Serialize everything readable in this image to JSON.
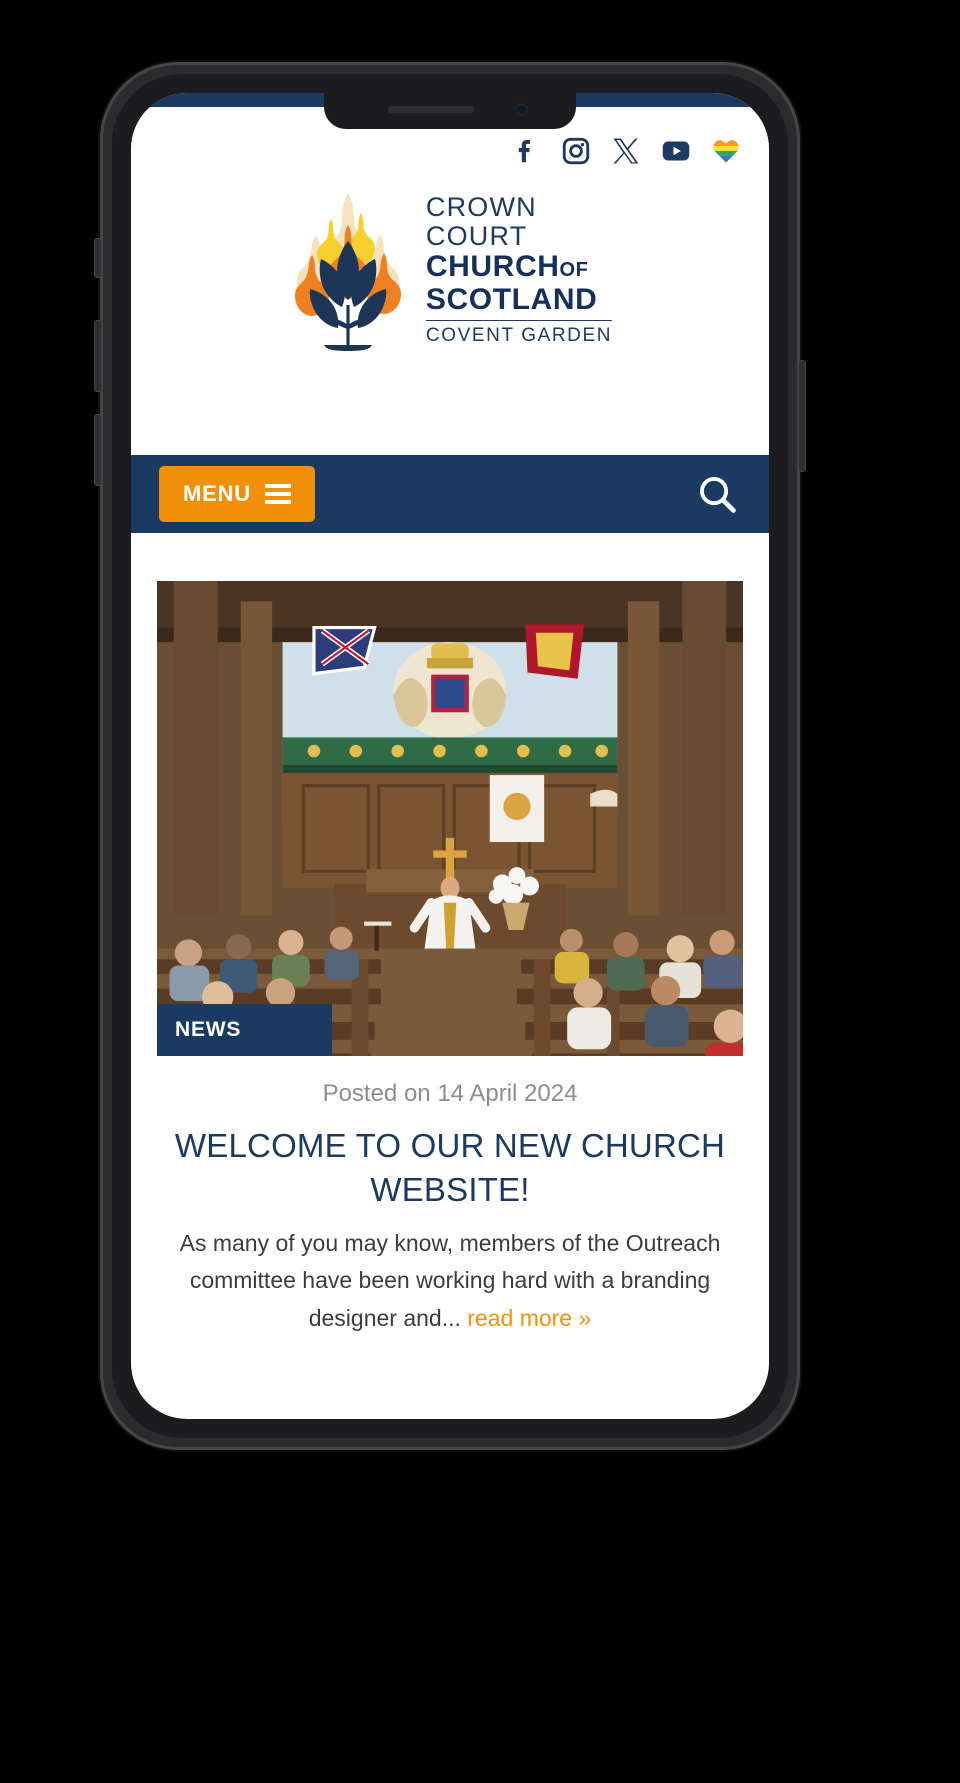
{
  "device": {
    "name": "smartphone-mockup"
  },
  "header": {
    "social": [
      {
        "name": "facebook-icon",
        "label": "Facebook"
      },
      {
        "name": "instagram-icon",
        "label": "Instagram"
      },
      {
        "name": "x-twitter-icon",
        "label": "X"
      },
      {
        "name": "youtube-icon",
        "label": "YouTube"
      },
      {
        "name": "pride-heart-icon",
        "label": "Inclusive Church"
      }
    ],
    "logo": {
      "line1": "CROWN",
      "line2": "COURT",
      "line3_main": "CHURCH",
      "line3_small": "OF",
      "line4": "SCOTLAND",
      "line5": "COVENT GARDEN",
      "alt": "Crown Court Church of Scotland flame and leaves logo"
    }
  },
  "nav": {
    "menu_label": "MENU",
    "menu_icon": "hamburger-icon",
    "search_icon": "search-icon",
    "search_label": "Search"
  },
  "article": {
    "category_badge": "NEWS",
    "image_alt": "Minister preaching to a congregation inside Crown Court Church sanctuary",
    "posted_label": "Posted on 14 April 2024",
    "headline": "WELCOME TO OUR NEW CHURCH WEBSITE!",
    "excerpt": "As many of you may know, members of the Outreach committee have been working hard with a branding designer and...",
    "read_more": "read more »"
  },
  "colors": {
    "navy": "#1b3a61",
    "orange": "#f29109",
    "white": "#ffffff",
    "muted_grey": "#8d8d8d"
  }
}
